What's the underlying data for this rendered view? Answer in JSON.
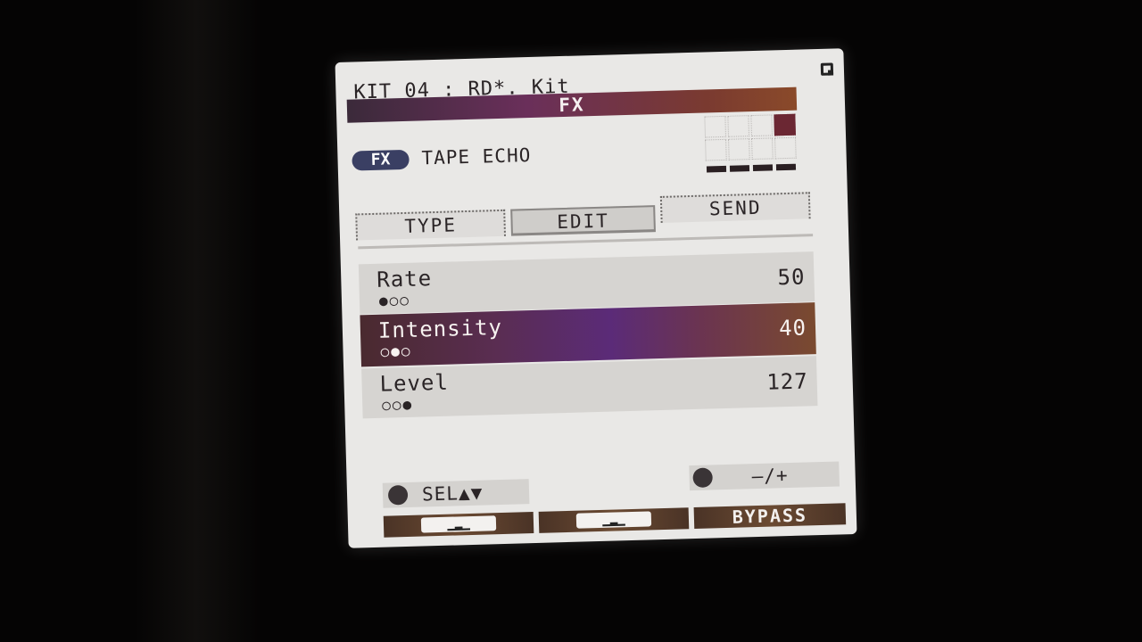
{
  "header": {
    "kit_line": "KIT 04 : RD*.   Kit",
    "title": "FX"
  },
  "effect": {
    "badge": "FX",
    "name": "TAPE ECHO"
  },
  "tabs": [
    {
      "label": "TYPE",
      "active": false
    },
    {
      "label": "EDIT",
      "active": true
    },
    {
      "label": "SEND",
      "active": false
    }
  ],
  "params": [
    {
      "name": "Rate",
      "dots": "●○○",
      "value": "50",
      "selected": false
    },
    {
      "name": "Intensity",
      "dots": "○●○",
      "value": "40",
      "selected": true
    },
    {
      "name": "Level",
      "dots": "○○●",
      "value": "127",
      "selected": false
    }
  ],
  "hints": {
    "left": "SEL▲▼",
    "right": "–/+"
  },
  "softkeys": {
    "one": "▁▂▁",
    "two": "▁▂▁",
    "three": "BYPASS"
  },
  "colors": {
    "accent": "#5b2b78",
    "title_bar": "#6a2f5a",
    "grid_active": "#6b2733"
  }
}
